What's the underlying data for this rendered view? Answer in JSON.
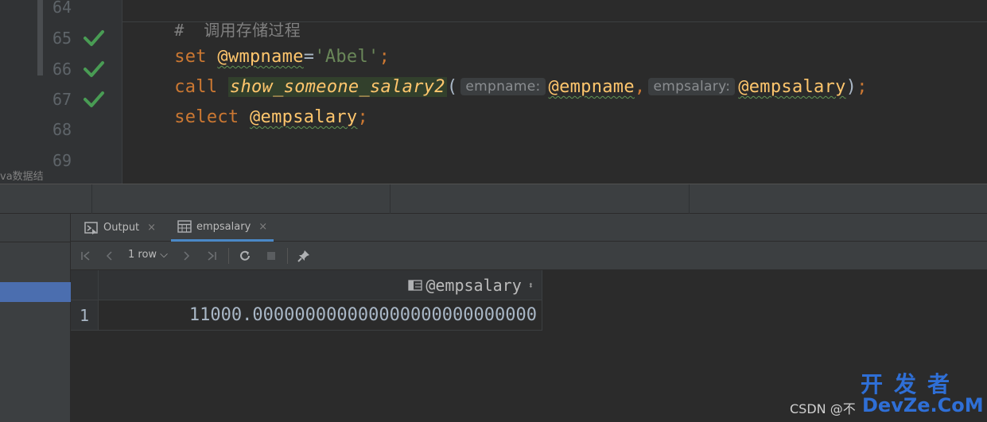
{
  "editor": {
    "left_strip_label": "va数据结",
    "lines": [
      {
        "num": "64"
      },
      {
        "num": "65"
      },
      {
        "num": "66"
      },
      {
        "num": "67"
      },
      {
        "num": "68"
      },
      {
        "num": "69"
      }
    ],
    "line64": {
      "comment": "#  调用存储过程"
    },
    "line65": {
      "kw": "set",
      "var": "@wmpname",
      "eq": "=",
      "str": "'Abel'",
      "semi": ";"
    },
    "line66": {
      "kw": "call",
      "fn": "show_someone_salary2",
      "open": "(",
      "hint1": "empname:",
      "arg1": "@empname",
      "comma": ",",
      "hint2": "empsalary:",
      "arg2": "@empsalary",
      "close": ")",
      "semi": ";"
    },
    "line67": {
      "kw": "select",
      "var": "@empsalary",
      "semi": ";"
    },
    "check_icon_color": "#499c54"
  },
  "results": {
    "tabs": [
      {
        "label": "Output",
        "icon": "output-console-icon",
        "close": "×"
      },
      {
        "label": "empsalary",
        "icon": "table-grid-icon",
        "close": "×"
      }
    ],
    "toolbar": {
      "rows_label": "1 row ⌵",
      "icons": [
        "first-page-icon",
        "previous-page-icon",
        "next-page-icon",
        "last-page-icon",
        "refresh-icon",
        "stop-icon",
        "pin-icon"
      ]
    },
    "grid": {
      "columns": [
        {
          "title": "@empsalary",
          "sort": "⬍"
        }
      ],
      "rows": [
        {
          "num": "1",
          "cells": [
            "11000.000000000000000000000000000"
          ]
        }
      ]
    }
  },
  "watermark": {
    "csdn": "CSDN @不",
    "cn": "开发者",
    "en": "DevZe.CoM"
  }
}
